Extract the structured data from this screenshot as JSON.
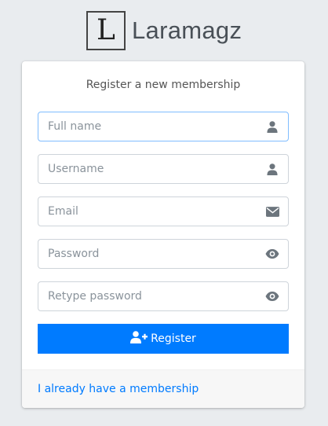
{
  "brand": {
    "logo_letter": "L",
    "name": "Laramagz"
  },
  "form": {
    "title": "Register a new membership",
    "fields": [
      {
        "placeholder": "Full name",
        "value": "",
        "icon": "user-icon"
      },
      {
        "placeholder": "Username",
        "value": "",
        "icon": "user-icon"
      },
      {
        "placeholder": "Email",
        "value": "",
        "icon": "envelope-icon"
      },
      {
        "placeholder": "Password",
        "value": "",
        "icon": "eye-icon"
      },
      {
        "placeholder": "Retype password",
        "value": "",
        "icon": "eye-icon"
      }
    ],
    "submit_label": "Register",
    "submit_icon": "user-plus-icon"
  },
  "footer": {
    "link_text": "I already have a membership"
  },
  "colors": {
    "primary": "#007bff",
    "background": "#e9ecef",
    "icon": "#6c757d",
    "focus_border": "#80bdff"
  }
}
